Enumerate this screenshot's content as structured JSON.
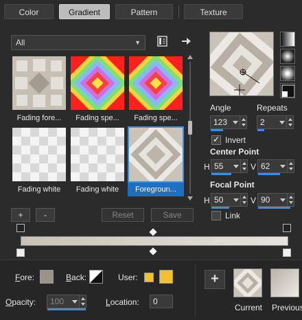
{
  "tabs": [
    {
      "label": "Color",
      "active": false
    },
    {
      "label": "Gradient",
      "active": true
    },
    {
      "label": "Pattern",
      "active": false
    },
    {
      "label": "Texture",
      "active": false
    }
  ],
  "filter": {
    "value": "All"
  },
  "gallery": [
    {
      "label": "Fading fore...",
      "thumb": "fading-foreground",
      "selected": false
    },
    {
      "label": "Fading spe...",
      "thumb": "fading-spectrum",
      "selected": false
    },
    {
      "label": "Fading spe...",
      "thumb": "fading-spectrum",
      "selected": false
    },
    {
      "label": "Fading white",
      "thumb": "fading-white",
      "selected": false
    },
    {
      "label": "Fading white",
      "thumb": "fading-white",
      "selected": false
    },
    {
      "label": "Foregroun...",
      "thumb": "foreground-background",
      "selected": true
    }
  ],
  "buttons": {
    "add": "+",
    "remove": "-",
    "reset": "Reset",
    "save": "Save"
  },
  "properties": {
    "angle_label": "Angle",
    "angle": "123",
    "angle_fraction": 0.34,
    "repeats_label": "Repeats",
    "repeats": "2",
    "repeats_fraction": 0.2,
    "invert_label": "Invert",
    "invert_checked": true,
    "center_label": "Center Point",
    "center_h": "55",
    "center_v": "62",
    "focal_label": "Focal Point",
    "focal_h": "50",
    "focal_v": "90",
    "link_label": "Link",
    "link_checked": false,
    "h": "H",
    "v": "V"
  },
  "footer": {
    "fore_label": "Fore:",
    "back_label": "Back:",
    "user_label": "User:",
    "opacity_label": "Opacity:",
    "opacity": "100",
    "location_label": "Location:",
    "location": "0",
    "current_label": "Current",
    "previous_label": "Previous",
    "add_label": "+"
  },
  "colors": {
    "accent": "#3a8fe0",
    "user_swatch": "#f2c12e",
    "gradient_start": "#c8c2b8",
    "gradient_end": "#e6e3de",
    "fore_swatch": "#9a938a"
  }
}
